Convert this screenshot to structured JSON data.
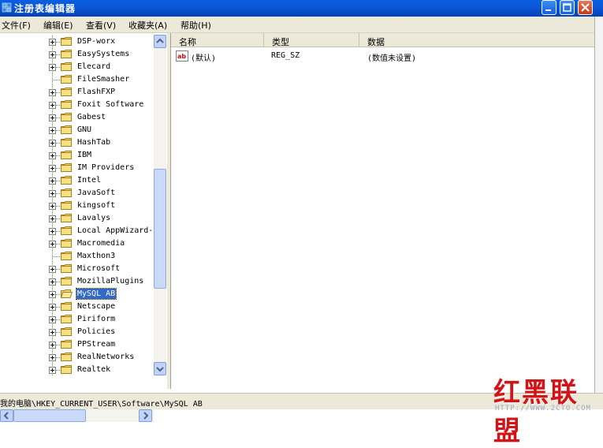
{
  "window": {
    "title": "注册表编辑器",
    "minimize_icon": "minimize-icon",
    "maximize_icon": "maximize-icon",
    "close_icon": "close-icon"
  },
  "menu": [
    "文件(F)",
    "编辑(E)",
    "查看(V)",
    "收藏夹(A)",
    "帮助(H)"
  ],
  "tree": {
    "items": [
      {
        "label": "DSP-worx",
        "expandable": true
      },
      {
        "label": "EasySystems",
        "expandable": true
      },
      {
        "label": "Elecard",
        "expandable": true
      },
      {
        "label": "FileSmasher",
        "expandable": false
      },
      {
        "label": "FlashFXP",
        "expandable": true
      },
      {
        "label": "Foxit Software",
        "expandable": true
      },
      {
        "label": "Gabest",
        "expandable": true
      },
      {
        "label": "GNU",
        "expandable": true
      },
      {
        "label": "HashTab",
        "expandable": true
      },
      {
        "label": "IBM",
        "expandable": true
      },
      {
        "label": "IM Providers",
        "expandable": true
      },
      {
        "label": "Intel",
        "expandable": true
      },
      {
        "label": "JavaSoft",
        "expandable": true
      },
      {
        "label": "kingsoft",
        "expandable": true
      },
      {
        "label": "Lavalys",
        "expandable": true
      },
      {
        "label": "Local AppWizard-",
        "expandable": true
      },
      {
        "label": "Macromedia",
        "expandable": true
      },
      {
        "label": "Maxthon3",
        "expandable": false
      },
      {
        "label": "Microsoft",
        "expandable": true
      },
      {
        "label": "MozillaPlugins",
        "expandable": true
      },
      {
        "label": "MySQL AB",
        "expandable": true,
        "selected": true
      },
      {
        "label": "Netscape",
        "expandable": true
      },
      {
        "label": "Piriform",
        "expandable": true
      },
      {
        "label": "Policies",
        "expandable": true
      },
      {
        "label": "PPStream",
        "expandable": true
      },
      {
        "label": "RealNetworks",
        "expandable": true
      },
      {
        "label": "Realtek",
        "expandable": true
      }
    ]
  },
  "list": {
    "headers": {
      "name": "名称",
      "type": "类型",
      "data": "数据"
    },
    "rows": [
      {
        "name": "(默认)",
        "type": "REG_SZ",
        "data": "(数值未设置)",
        "icon": "string-value-icon"
      }
    ]
  },
  "status": {
    "path": "我的电脑\\HKEY_CURRENT_USER\\Software\\MySQL AB"
  },
  "watermark": {
    "text": "红黑联盟",
    "url": "HTTP://WWW.2CTO.COM"
  },
  "colors": {
    "titlebar": "#0a58d8",
    "selection": "#316ac5",
    "folder": "#f5d76e",
    "watermark": "#d21418"
  }
}
